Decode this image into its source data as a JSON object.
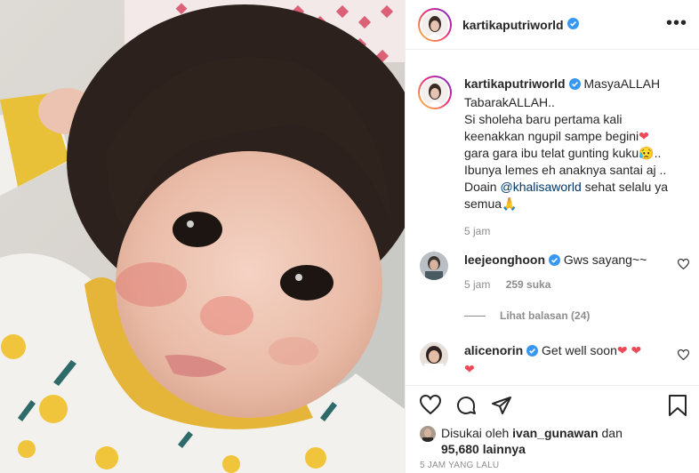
{
  "post": {
    "author": "kartikaputriworld",
    "verified": true,
    "caption": {
      "lines": [
        "MasyaALLAH",
        "TabarakALLAH..",
        "Si sholeha baru pertama kali",
        "keenakkan ngupil sampe begini",
        "gara gara ibu telat gunting kuku",
        "Ibunya lemes eh anaknya santai aj ..",
        "Doain"
      ],
      "mention": "@khalisaworld",
      "after_mention": " sehat selalu ya",
      "last_line": "semua",
      "line4_emoji": "❤",
      "line5_emoji": "😥..",
      "last_emoji": "🙏"
    },
    "caption_time": "5 jam"
  },
  "comments": [
    {
      "user": "leejeonghoon",
      "text": "Gws sayang~~",
      "time": "5 jam",
      "likes": "259 suka"
    },
    {
      "user": "alicenorin",
      "text": "Get well soon",
      "hearts": "❤ ❤",
      "second_line": "❤"
    }
  ],
  "view_replies": "Lihat balasan (24)",
  "likes": {
    "prefix": "Disukai oleh ",
    "liker": "ivan_gunawan",
    "middle": " dan",
    "count": "95,680",
    "suffix": " lainnya"
  },
  "posted_ago": "5 JAM YANG LALU",
  "icons": [
    "verified-badge-icon",
    "more-options-icon",
    "heart-icon",
    "comment-icon",
    "share-icon",
    "save-icon"
  ],
  "colors": {
    "verified": "#3897f0",
    "heart": "#ed4956",
    "mention": "#00376b",
    "muted": "#8e8e8e"
  }
}
